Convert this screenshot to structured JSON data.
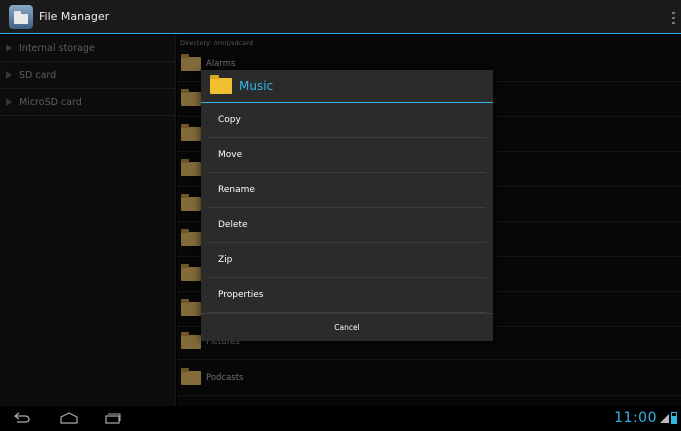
{
  "app": {
    "title": "File Manager"
  },
  "sidebar": {
    "items": [
      {
        "label": "Internal storage"
      },
      {
        "label": "SD card"
      },
      {
        "label": "MicroSD card"
      }
    ]
  },
  "main": {
    "directory": "Directory: /mnt/sdcard",
    "files": [
      {
        "name": "Alarms"
      },
      {
        "name": ""
      },
      {
        "name": ""
      },
      {
        "name": ""
      },
      {
        "name": ""
      },
      {
        "name": ""
      },
      {
        "name": ""
      },
      {
        "name": ""
      },
      {
        "name": "Pictures"
      },
      {
        "name": "Podcasts"
      }
    ]
  },
  "dialog": {
    "title": "Music",
    "items": [
      {
        "label": "Copy"
      },
      {
        "label": "Move"
      },
      {
        "label": "Rename"
      },
      {
        "label": "Delete"
      },
      {
        "label": "Zip"
      },
      {
        "label": "Properties"
      }
    ],
    "cancel_label": "Cancel"
  },
  "status": {
    "time": "11:00"
  },
  "colors": {
    "accent": "#33b5e5",
    "folder": "#c8a45a",
    "dialog_folder": "#f0c030"
  },
  "icons": {
    "app": "file-manager-icon",
    "overflow": "overflow-menu-icon",
    "back": "back-icon",
    "home": "home-icon",
    "recent": "recent-apps-icon",
    "signal": "signal-icon",
    "battery": "battery-icon"
  }
}
